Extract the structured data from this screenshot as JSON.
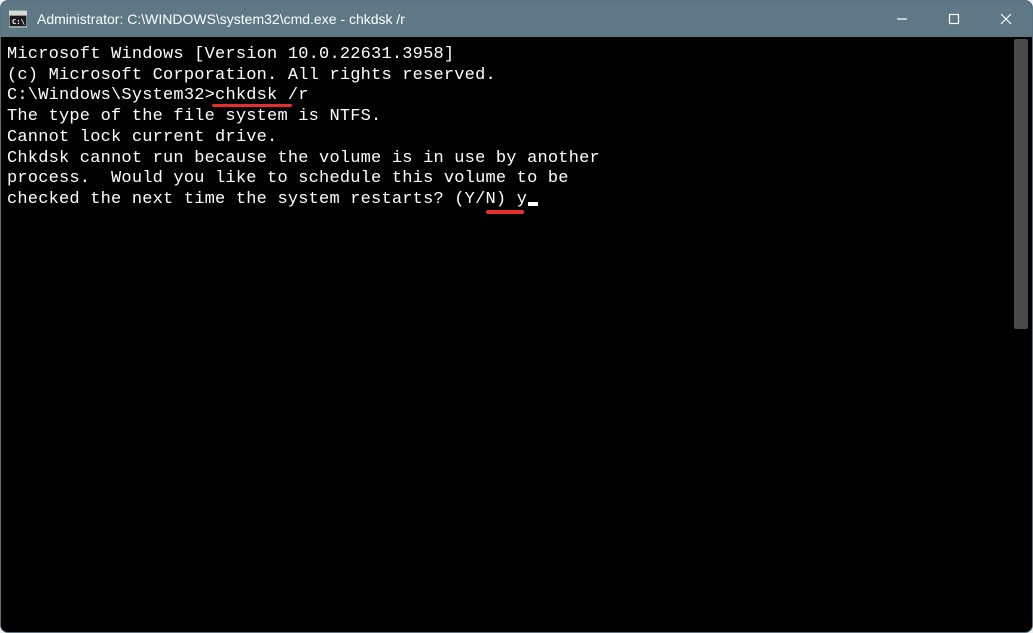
{
  "window": {
    "title": "Administrator: C:\\WINDOWS\\system32\\cmd.exe - chkdsk  /r"
  },
  "console": {
    "line1": "Microsoft Windows [Version 10.0.22631.3958]",
    "line2": "(c) Microsoft Corporation. All rights reserved.",
    "blank1": "",
    "prompt_prefix": "C:\\Windows\\System32>",
    "prompt_command": "chkdsk /r",
    "line4": "The type of the file system is NTFS.",
    "line5": "Cannot lock current drive.",
    "blank2": "",
    "line6": "Chkdsk cannot run because the volume is in use by another",
    "line7": "process.  Would you like to schedule this volume to be",
    "line8_prefix": "checked the next time the system restarts? (Y/N) ",
    "line8_answer": "y"
  }
}
